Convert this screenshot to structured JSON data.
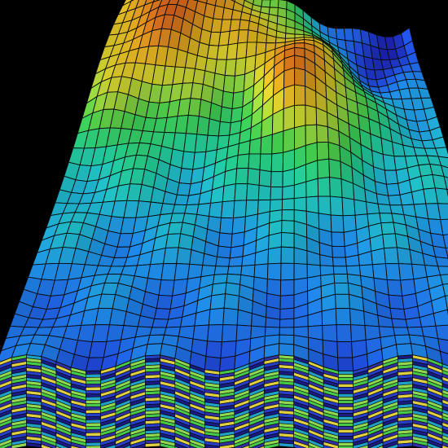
{
  "scene": {
    "background": "#000000",
    "object": "3d-reservoir-grid-model",
    "grid_line_color": "#0a0a0a",
    "colormap": [
      "#1a1aa0",
      "#1f4fd8",
      "#1e88e0",
      "#1fb8c0",
      "#22c58a",
      "#3cc24a",
      "#8fc83a",
      "#c9c22a",
      "#d4a41e",
      "#cf7a1c",
      "#c2571a"
    ],
    "side_layer_colors": [
      "#e0d040",
      "#48c848",
      "#20a0c8",
      "#2840c8",
      "#3030a0",
      "#90d850",
      "#1a1a80"
    ]
  }
}
